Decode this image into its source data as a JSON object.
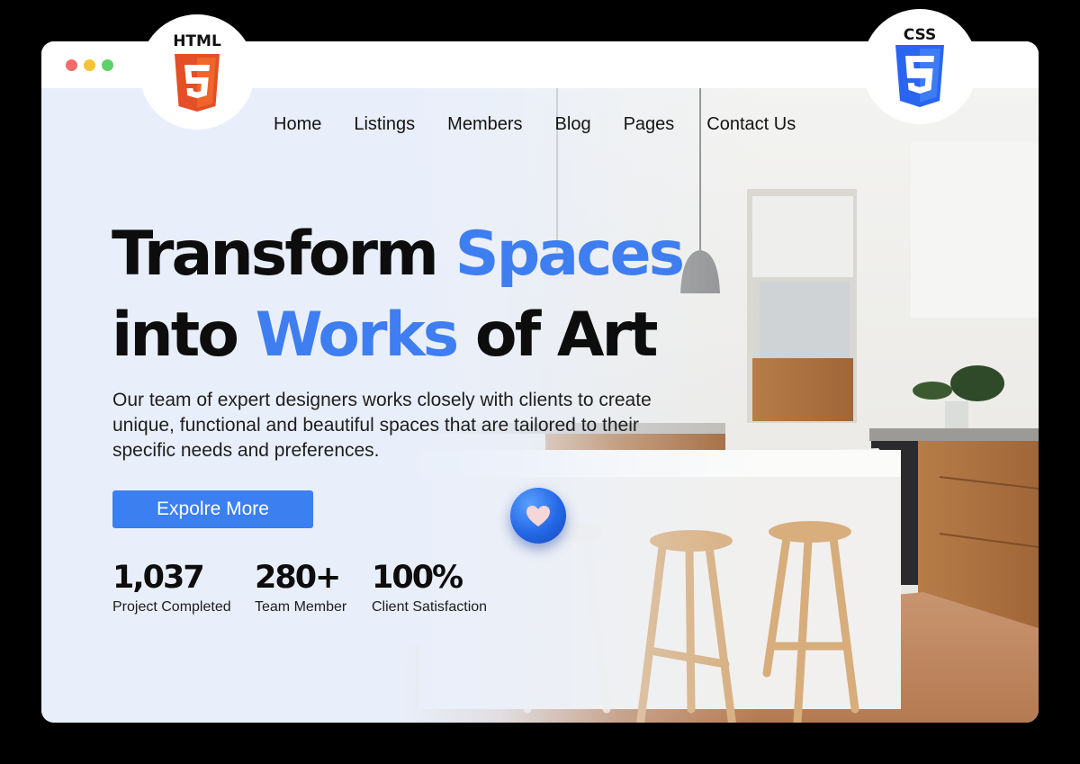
{
  "window": {
    "controls": [
      "close",
      "minimize",
      "maximize"
    ]
  },
  "badges": {
    "html": "HTML",
    "css": "CSS"
  },
  "nav": {
    "items": [
      "Home",
      "Listings",
      "Members",
      "Blog",
      "Pages",
      "Contact Us"
    ]
  },
  "hero": {
    "line1_plain": "Transform",
    "line1_accent": "Spaces",
    "line2_plain_before": "into",
    "line2_accent": "Works",
    "line2_plain_after": "of Art",
    "description": "Our team of expert designers works closely with clients to create unique, functional and beautiful spaces that are tailored to their specific needs and preferences.",
    "cta_label": "Expolre More"
  },
  "stats": [
    {
      "value": "1,037",
      "label": "Project Completed"
    },
    {
      "value": "280+",
      "label": "Team Member"
    },
    {
      "value": "100%",
      "label": "Client Satisfaction"
    }
  ],
  "icons": {
    "like": "heart-icon",
    "html": "html5-logo-icon",
    "css": "css3-logo-icon"
  },
  "colors": {
    "accent": "#3e7ef0",
    "button": "#3b7ff0",
    "background": "#e9effa",
    "html5": "#e34f26",
    "css3": "#2965f1"
  }
}
